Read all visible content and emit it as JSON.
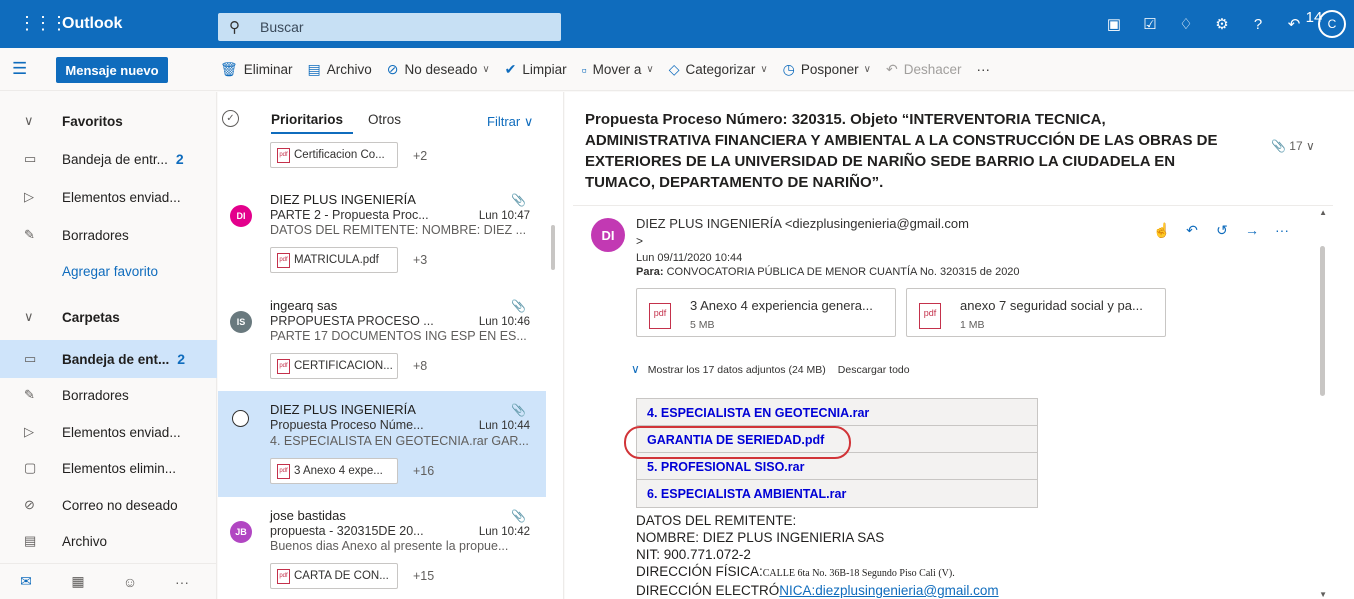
{
  "topbar": {
    "app_name": "Outlook",
    "search_placeholder": "Buscar",
    "notification_count": "14",
    "user_initial": "C",
    "help": "?"
  },
  "commands": {
    "new_message": "Mensaje nuevo",
    "delete": "Eliminar",
    "archive": "Archivo",
    "junk": "No deseado",
    "sweep": "Limpiar",
    "move": "Mover a",
    "categorize": "Categorizar",
    "snooze": "Posponer",
    "undo": "Deshacer",
    "more": "···"
  },
  "nav": {
    "favorites": "Favoritos",
    "fav_inbox": "Bandeja de entr...",
    "fav_inbox_count": "2",
    "fav_sent": "Elementos enviad...",
    "fav_drafts": "Borradores",
    "add_favorite": "Agregar favorito",
    "folders": "Carpetas",
    "inbox": "Bandeja de ent...",
    "inbox_count": "2",
    "drafts": "Borradores",
    "sent": "Elementos enviad...",
    "deleted": "Elementos elimin...",
    "junk": "Correo no deseado",
    "archive": "Archivo"
  },
  "list": {
    "tab_focused": "Prioritarios",
    "tab_other": "Otros",
    "filter": "Filtrar",
    "top_chip": "Certificacion Co...",
    "top_plus": "+2",
    "messages": [
      {
        "initials": "DI",
        "color": "#e3008c",
        "from": "DIEZ PLUS INGENIERÍA",
        "subject": "PARTE 2 - Propuesta Proc...",
        "time": "Lun 10:47",
        "preview": "DATOS DEL REMITENTE: NOMBRE: DIEZ ...",
        "chip": "MATRICULA.pdf",
        "plus": "+3"
      },
      {
        "initials": "IS",
        "color": "#69797e",
        "from": "ingearq sas",
        "subject": "PRPOPUESTA PROCESO ...",
        "time": "Lun 10:46",
        "preview": "PARTE 17 DOCUMENTOS ING ESP EN ES...",
        "chip": "CERTIFICACION...",
        "plus": "+8"
      },
      {
        "initials": "",
        "color": "",
        "from": "DIEZ PLUS INGENIERÍA",
        "subject": "Propuesta Proceso Núme...",
        "time": "Lun 10:44",
        "preview": "4. ESPECIALISTA EN GEOTECNIA.rar GAR...",
        "chip": "3 Anexo 4 expe...",
        "plus": "+16"
      },
      {
        "initials": "JB",
        "color": "#b146c2",
        "from": "jose bastidas",
        "subject": "propuesta - 320315DE 20...",
        "time": "Lun 10:42",
        "preview": "Buenos dias Anexo al presente la propue...",
        "chip": "CARTA DE CON...",
        "plus": "+15"
      }
    ]
  },
  "reading": {
    "title": "Propuesta Proceso Número: 320315. Objeto “INTERVENTORIA TECNICA, ADMINISTRATIVA FINANCIERA Y AMBIENTAL A LA CONSTRUCCIÓN DE LAS OBRAS DE EXTERIORES DE LA UNIVERSIDAD DE NARIÑO SEDE BARRIO LA CIUDADELA EN TUMACO, DEPARTAMENTO DE NARIÑO”.",
    "attachment_count": "17",
    "sender_initials": "DI",
    "from": "DIEZ PLUS INGENIERÍA <diezplusingenieria@gmail.com",
    "from_gt": ">",
    "date": "Lun 09/11/2020 10:44",
    "to_label": "Para:",
    "to": "CONVOCATORIA PÚBLICA DE MENOR CUANTÍA No. 320315 de 2020",
    "attachments": [
      {
        "name": "3 Anexo 4 experiencia genera...",
        "size": "5 MB",
        "type": "pdf"
      },
      {
        "name": "anexo 7 seguridad social y pa...",
        "size": "1 MB",
        "type": "pdf"
      }
    ],
    "show_all": "Mostrar los 17 datos adjuntos (24 MB)",
    "download_all": "Descargar todo",
    "files": [
      "4. ESPECIALISTA EN GEOTECNIA.rar",
      "GARANTIA DE SERIEDAD.pdf",
      "5. PROFESIONAL SISO.rar",
      "6. ESPECIALISTA AMBIENTAL.rar"
    ],
    "body": {
      "line1": "DATOS DEL REMITENTE:",
      "line2": "NOMBRE: DIEZ PLUS INGENIERIA SAS",
      "line3": "NIT: 900.771.072-2",
      "line4_label": "DIRECCIÓN FÍSICA:",
      "line4_value": "CALLE 6ta No. 36B-18 Segundo Piso Cali (V).",
      "line5_label": "DIRECCIÓN ELECTRÓ",
      "line5_link": "NICA:diezplusingenieria@gmail.com"
    }
  }
}
